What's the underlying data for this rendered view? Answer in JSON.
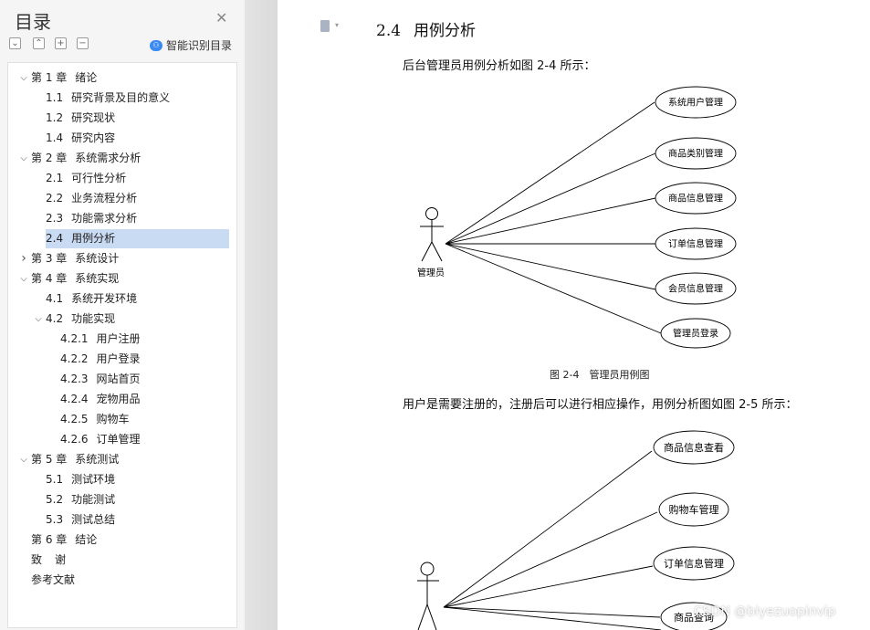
{
  "sidebar": {
    "title": "目录",
    "smart_label": "智能识别目录",
    "toolbar": [
      "expand-all",
      "collapse-all",
      "add",
      "remove"
    ],
    "items": [
      {
        "num": "第 1 章",
        "label": "绪论",
        "level": 0,
        "arrow": "down"
      },
      {
        "num": "1.1",
        "label": "研究背景及目的意义",
        "level": 1
      },
      {
        "num": "1.2",
        "label": "研究现状",
        "level": 1
      },
      {
        "num": "1.4",
        "label": "研究内容",
        "level": 1
      },
      {
        "num": "第 2 章",
        "label": "系统需求分析",
        "level": 0,
        "arrow": "down"
      },
      {
        "num": "2.1",
        "label": "可行性分析",
        "level": 1
      },
      {
        "num": "2.2",
        "label": "业务流程分析",
        "level": 1
      },
      {
        "num": "2.3",
        "label": "功能需求分析",
        "level": 1
      },
      {
        "num": "2.4",
        "label": "用例分析",
        "level": 1,
        "selected": true
      },
      {
        "num": "第 3 章",
        "label": "系统设计",
        "level": 0,
        "arrow": "right"
      },
      {
        "num": "第 4 章",
        "label": "系统实现",
        "level": 0,
        "arrow": "down"
      },
      {
        "num": "4.1",
        "label": "系统开发环境",
        "level": 1
      },
      {
        "num": "4.2",
        "label": "功能实现",
        "level": 1,
        "arrow": "down"
      },
      {
        "num": "4.2.1",
        "label": "用户注册",
        "level": 2
      },
      {
        "num": "4.2.2",
        "label": "用户登录",
        "level": 2
      },
      {
        "num": "4.2.3",
        "label": "网站首页",
        "level": 2
      },
      {
        "num": "4.2.4",
        "label": "宠物用品",
        "level": 2
      },
      {
        "num": "4.2.5",
        "label": "购物车",
        "level": 2
      },
      {
        "num": "4.2.6",
        "label": "订单管理",
        "level": 2
      },
      {
        "num": "第 5 章",
        "label": "系统测试",
        "level": 0,
        "arrow": "down"
      },
      {
        "num": "5.1",
        "label": "测试环境",
        "level": 1
      },
      {
        "num": "5.2",
        "label": "功能测试",
        "level": 1
      },
      {
        "num": "5.3",
        "label": "测试总结",
        "level": 1
      },
      {
        "num": "第 6 章",
        "label": "结论",
        "level": 0
      },
      {
        "num": "致",
        "label": "谢",
        "level": 0
      },
      {
        "num": "参考文献",
        "label": "",
        "level": 0
      }
    ]
  },
  "document": {
    "section_num": "2.4",
    "section_title": "用例分析",
    "para1": "后台管理员用例分析如图 2-4 所示：",
    "diagram1": {
      "actor": "管理员",
      "usecases": [
        "系统用户管理",
        "商品类别管理",
        "商品信息管理",
        "订单信息管理",
        "会员信息管理",
        "管理员登录"
      ]
    },
    "caption1": "图 2-4　管理员用例图",
    "para2": "用户是需要注册的，注册后可以进行相应操作，用例分析图如图 2-5 所示：",
    "diagram2": {
      "usecases": [
        "商品信息查看",
        "购物车管理",
        "订单信息管理",
        "商品查询"
      ]
    }
  },
  "watermark": "CSDN @biyezuopinvip"
}
